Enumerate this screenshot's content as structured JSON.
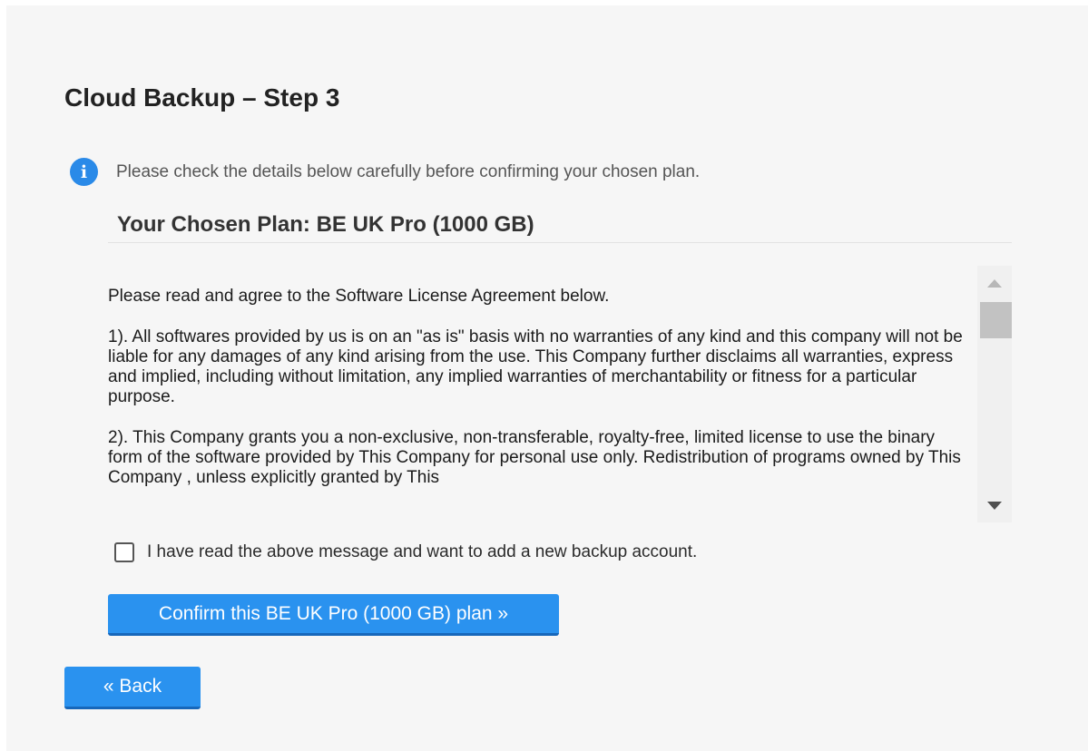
{
  "page": {
    "title": "Cloud Backup – Step 3"
  },
  "info": {
    "icon": "info-icon",
    "icon_glyph": "i",
    "message": "Please check the details below carefully before confirming your chosen plan."
  },
  "plan": {
    "heading": "Your Chosen Plan: BE UK Pro (1000 GB)"
  },
  "license": {
    "paragraphs": [
      "Please read and agree to the Software License Agreement below.",
      "1). All softwares provided by us is on an \"as is\" basis with no warranties of any kind and this company will not be liable for any damages of any kind arising from the use. This Company further disclaims all warranties, express and implied, including without limitation, any implied warranties of merchantability or fitness for a particular purpose.",
      "2). This Company grants you a non-exclusive, non-transferable, royalty-free, limited license to use the binary form of the software provided by This Company for personal use only. Redistribution of programs owned by This Company , unless explicitly granted by This"
    ]
  },
  "agreement": {
    "label": "I have read the above message and want to add a new backup account.",
    "checked": false
  },
  "buttons": {
    "confirm": "Confirm this BE UK Pro (1000 GB) plan »",
    "back": "« Back"
  },
  "colors": {
    "accent": "#2a92ef",
    "accent_dark": "#1767ba",
    "info_icon": "#2a8ae8",
    "background": "#f6f6f6"
  }
}
